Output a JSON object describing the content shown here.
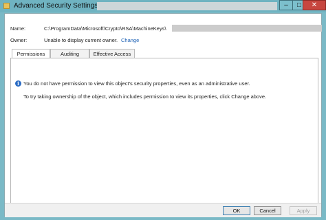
{
  "window": {
    "title": "Advanced Security Settings for",
    "controls": {
      "minimize": "–",
      "maximize": "□",
      "close": "✕"
    }
  },
  "header": {
    "name_label": "Name:",
    "name_value": "C:\\ProgramData\\Microsoft\\Crypto\\RSA\\MachineKeys\\",
    "owner_label": "Owner:",
    "owner_value": "Unable to display current owner.",
    "change_link": "Change"
  },
  "tabs": [
    {
      "label": "Permissions",
      "active": true
    },
    {
      "label": "Auditing",
      "active": false
    },
    {
      "label": "Effective Access",
      "active": false
    }
  ],
  "content": {
    "info_icon_glyph": "i",
    "message_1": "You do not have permission to view this object's security properties, even as an administrative user.",
    "message_2": "To try taking ownership of the object, which includes permission to view its properties, click Change above."
  },
  "buttons": {
    "ok": "OK",
    "cancel": "Cancel",
    "apply": "Apply"
  }
}
